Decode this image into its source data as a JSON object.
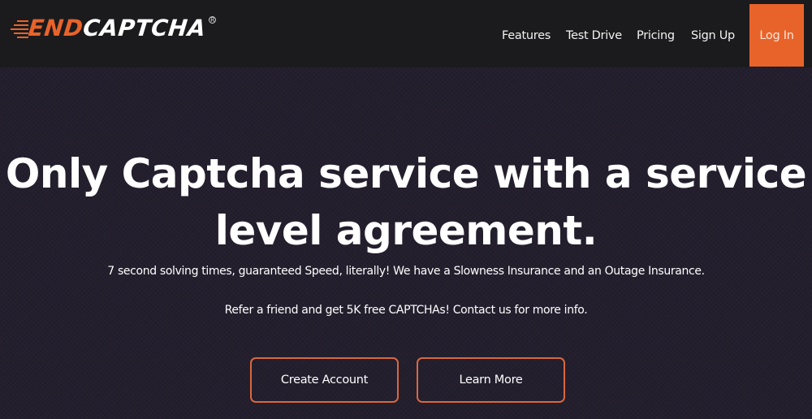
{
  "brand": {
    "logo_part1": "END",
    "logo_part2": "CAPTCHA",
    "registered_mark": "R",
    "accent_color": "#e8632a"
  },
  "nav": {
    "items": [
      {
        "label": "Features"
      },
      {
        "label": "Test Drive"
      },
      {
        "label": "Pricing"
      },
      {
        "label": "Sign Up"
      }
    ],
    "login_label": "Log In"
  },
  "hero": {
    "headline_line1": "Only Captcha service with a service",
    "headline_line2": "level agreement.",
    "subtext1": "7 second solving times, guaranteed Speed, literally! We have a Slowness Insurance and an Outage Insurance.",
    "subtext2": "Refer a friend and get 5K free CAPTCHAs! Contact us for more info.",
    "buttons": [
      {
        "label": "Create Account"
      },
      {
        "label": "Learn More"
      }
    ]
  }
}
